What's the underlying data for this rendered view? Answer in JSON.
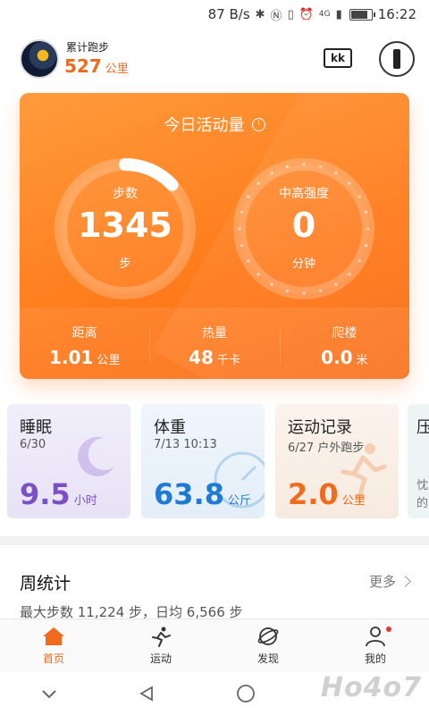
{
  "status_bar": {
    "speed": "87 B/s",
    "network": "4G",
    "time": "16:22",
    "battery_level": 0.85
  },
  "header": {
    "title": "累计跑步",
    "distance": "527",
    "unit": "公里"
  },
  "activity": {
    "title": "今日活动量",
    "steps": {
      "label": "步数",
      "value": "1345",
      "unit": "步",
      "progress": 0.13
    },
    "intensity": {
      "label": "中高强度",
      "value": "0",
      "unit": "分钟",
      "progress": 0
    },
    "stats": [
      {
        "label": "距离",
        "value": "1.01",
        "unit": "公里"
      },
      {
        "label": "热量",
        "value": "48",
        "unit": "千卡"
      },
      {
        "label": "爬楼",
        "value": "0.0",
        "unit": "米"
      }
    ]
  },
  "tiles": {
    "sleep": {
      "title": "睡眠",
      "date": "6/30",
      "value": "9.5",
      "unit": "小时"
    },
    "weight": {
      "title": "体重",
      "date": "7/13 10:13",
      "value": "63.8",
      "unit": "公斤"
    },
    "record": {
      "title": "运动记录",
      "date": "6/27 户外跑步",
      "value": "2.0",
      "unit": "公里"
    },
    "extra": {
      "title": "压",
      "sub_1": "忱",
      "sub_2": "的"
    }
  },
  "weekly": {
    "title": "周统计",
    "more": "更多",
    "desc": "最大步数 11,224 步，日均 6,566 步"
  },
  "nav": [
    {
      "label": "首页",
      "icon": "home-icon",
      "active": true
    },
    {
      "label": "运动",
      "icon": "run-icon",
      "active": false
    },
    {
      "label": "发现",
      "icon": "discover-icon",
      "active": false
    },
    {
      "label": "我的",
      "icon": "profile-icon",
      "active": false
    }
  ],
  "colors": {
    "accent": "#f06a1d",
    "sleep": "#7b4fc6",
    "weight": "#1f7ad6",
    "record": "#ef6c1c"
  },
  "watermark": "Ho4o7"
}
